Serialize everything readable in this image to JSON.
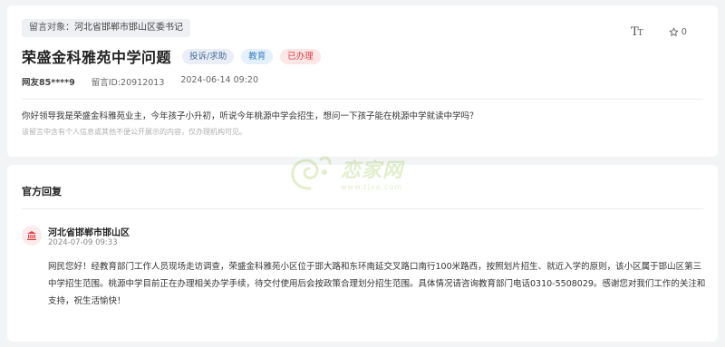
{
  "message": {
    "target_label": "留言对象：",
    "target_value": "河北省邯郸市邯山区委书记",
    "title": "荣盛金科雅苑中学问题",
    "tags": {
      "type": "投诉/求助",
      "domain": "教育",
      "status": "已办理"
    },
    "user": "网友85****9",
    "id_label": "留言ID:",
    "id_value": "20912013",
    "date": "2024-06-14 09:20",
    "content": "你好领导我是荣盛金科雅苑业主，今年孩子小升初，听说今年桃源中学会招生，想问一下孩子能在桃源中学就读中学吗？",
    "privacy_notice": "该留言中含有个人信息或其他不便公开展示的内容，仅办理机构可见。",
    "favorite_count": "0"
  },
  "reply": {
    "section_title": "官方回复",
    "department": "河北省邯郸市邯山区",
    "time": "2024-07-09 09:33",
    "text": "网民您好！经教育部门工作人员现场走访调查，荣盛金科雅苑小区位于邯大路和东环南延交叉路口南行100米路西，按照划片招生、就近入学的原则，该小区属于邯山区第三中学招生范围。桃源中学目前正在办理相关办学手续，待交付使用后会按政策合理划分招生范围。具体情况请咨询教育部门电话0310-5508029。感谢您对我们工作的关注和支持，祝生活愉快！"
  },
  "watermark": {
    "text": "恋家网",
    "url": "www.tjxa.com"
  },
  "icons": {
    "font_size": "font-size-icon",
    "favorite": "star-icon",
    "department": "government-building-icon"
  },
  "colors": {
    "status_red": "#d9434a",
    "domain_blue": "#3a7fc0",
    "watermark_green": "#7fb321"
  }
}
